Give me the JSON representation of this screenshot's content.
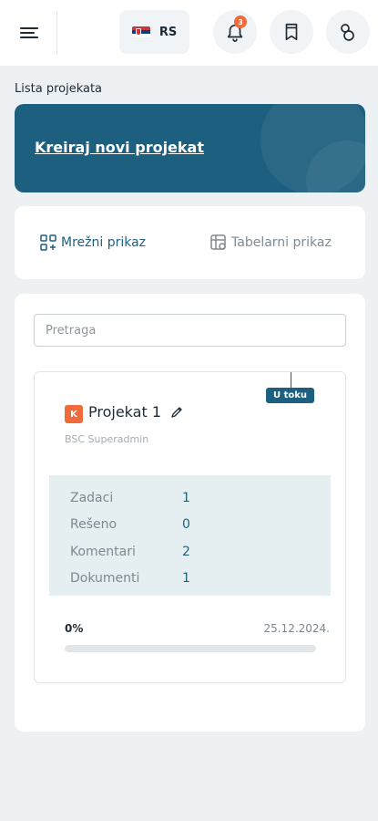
{
  "header": {
    "language_code": "RS",
    "notification_count": "3",
    "icons": {
      "menu": "hamburger-menu-icon",
      "flag": "serbia-flag-icon",
      "notifications": "bell-icon",
      "bookmarks": "bookmark-icon",
      "profile": "users-icon"
    }
  },
  "page": {
    "title": "Lista projekata",
    "create_label": "Kreiraj novi projekat"
  },
  "views": {
    "grid_label": "Mrežni prikaz",
    "table_label": "Tabelarni prikaz",
    "active": "grid"
  },
  "search": {
    "placeholder": "Pretraga",
    "value": ""
  },
  "projects": [
    {
      "badge_letter": "K",
      "name": "Projekat 1",
      "owner": "BSC Superadmin",
      "status": "U toku",
      "stats": [
        {
          "label": "Zadaci",
          "value": "1"
        },
        {
          "label": "Rešeno",
          "value": "0"
        },
        {
          "label": "Komentari",
          "value": "2"
        },
        {
          "label": "Dokumenti",
          "value": "1"
        }
      ],
      "progress_label": "0%",
      "progress": 0,
      "date": "25.12.2024."
    }
  ],
  "colors": {
    "brand": "#1d5f7e",
    "accent": "#f06a3a",
    "stats_bg": "#e5eff2"
  }
}
